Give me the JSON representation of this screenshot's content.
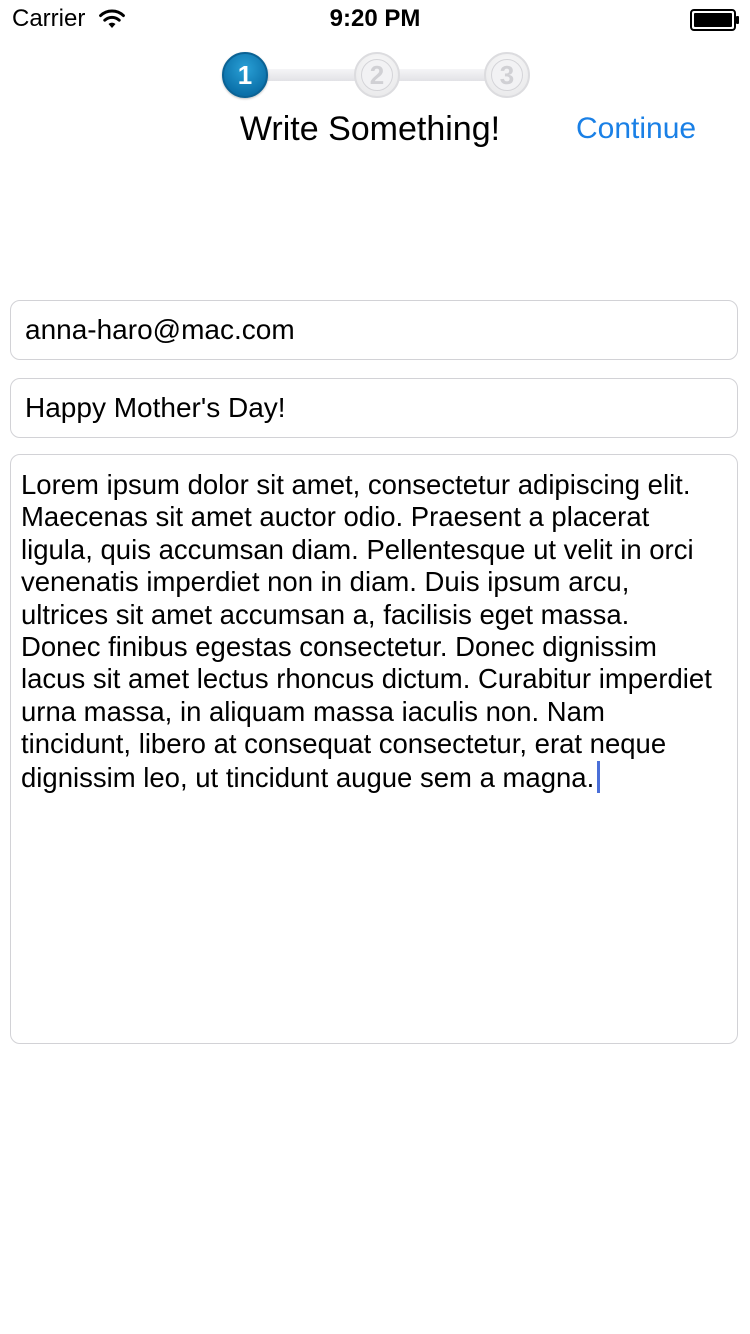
{
  "status_bar": {
    "carrier": "Carrier",
    "time": "9:20 PM",
    "icons": [
      "wifi-icon",
      "battery-icon"
    ]
  },
  "stepper": {
    "steps": [
      {
        "number": "1",
        "state": "active"
      },
      {
        "number": "2",
        "state": "inactive"
      },
      {
        "number": "3",
        "state": "inactive"
      }
    ],
    "active_color": "#0a7ab8",
    "inactive_color": "#e6e6e8"
  },
  "header": {
    "title": "Write Something!",
    "continue_label": "Continue",
    "accent_color": "#1a80e6"
  },
  "form": {
    "email_value": "anna-haro@mac.com",
    "subject_value": "Happy Mother's Day!",
    "message_value": "Lorem ipsum dolor sit amet, consectetur adipiscing elit.\nMaecenas sit amet auctor odio. Praesent a placerat\nligula, quis accumsan diam. Pellentesque ut velit in orci\nvenenatis imperdiet non in diam. Duis ipsum arcu,\nultrices sit amet accumsan a, facilisis eget massa.\nDonec finibus egestas consectetur. Donec dignissim\nlacus sit amet lectus rhoncus dictum. Curabitur imperdiet\nurna massa, in aliquam massa iaculis non. Nam\ntincidunt, libero at consequat consectetur, erat neque\ndignissim leo, ut tincidunt augue sem a magna."
  }
}
